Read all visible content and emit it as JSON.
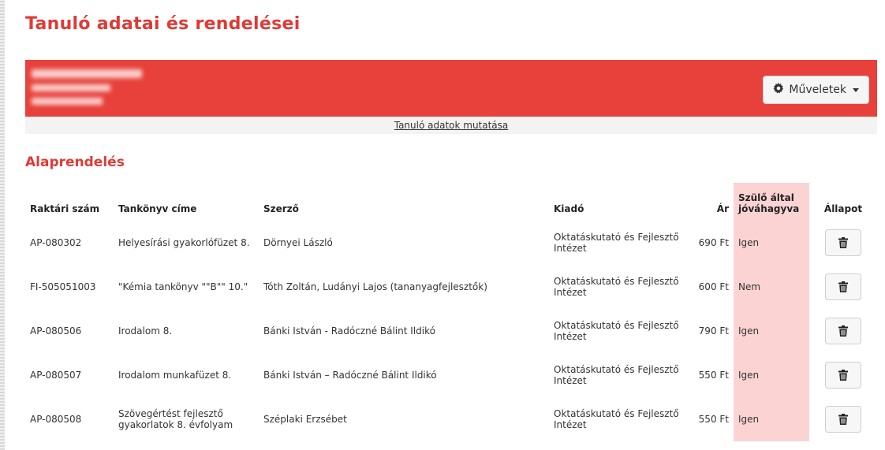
{
  "page": {
    "title": "Tanuló adatai és rendelései"
  },
  "student_panel": {
    "background": "#e8403a",
    "actions_label": "Műveletek",
    "actions_icon": "gear-icon",
    "toggle_label": "Tanuló adatok mutatása"
  },
  "section": {
    "title": "Alaprendelés"
  },
  "table": {
    "headers": {
      "stock_no": "Raktári szám",
      "book_title": "Tankönyv címe",
      "author": "Szerző",
      "publisher": "Kiadó",
      "price": "Ár",
      "parent_approved": "Szülő által jóváhagyva",
      "status": "Állapot"
    },
    "rows": [
      {
        "stock_no": "AP-080302",
        "book_title": "Helyesírási gyakorlófüzet 8.",
        "author": "Dörnyei László",
        "publisher": "Oktatáskutató és Fejlesztő Intézet",
        "price": "690 Ft",
        "parent_approved": "Igen"
      },
      {
        "stock_no": "FI-505051003",
        "book_title": "\"Kémia tankönyv \"\"B\"\" 10.\"",
        "author": "Tóth Zoltán, Ludányi Lajos (tananyagfejlesztők)",
        "publisher": "Oktatáskutató és Fejlesztő Intézet",
        "price": "600 Ft",
        "parent_approved": "Nem"
      },
      {
        "stock_no": "AP-080506",
        "book_title": "Irodalom 8.",
        "author": "Bánki István - Radóczné Bálint Ildikó",
        "publisher": "Oktatáskutató és Fejlesztő Intézet",
        "price": "790 Ft",
        "parent_approved": "Igen"
      },
      {
        "stock_no": "AP-080507",
        "book_title": "Irodalom munkafüzet 8.",
        "author": "Bánki István – Radóczné Bálint Ildikó",
        "publisher": "Oktatáskutató és Fejlesztő Intézet",
        "price": "550 Ft",
        "parent_approved": "Igen"
      },
      {
        "stock_no": "AP-080508",
        "book_title": "Szövegértést fejlesztő gyakorlatok 8. évfolyam",
        "author": "Széplaki Erzsébet",
        "publisher": "Oktatáskutató és Fejlesztő Intézet",
        "price": "550 Ft",
        "parent_approved": "Igen"
      }
    ],
    "delete_icon": "trash-icon"
  },
  "colors": {
    "accent": "#e03a35",
    "approved_column": "#fcd3d3"
  }
}
